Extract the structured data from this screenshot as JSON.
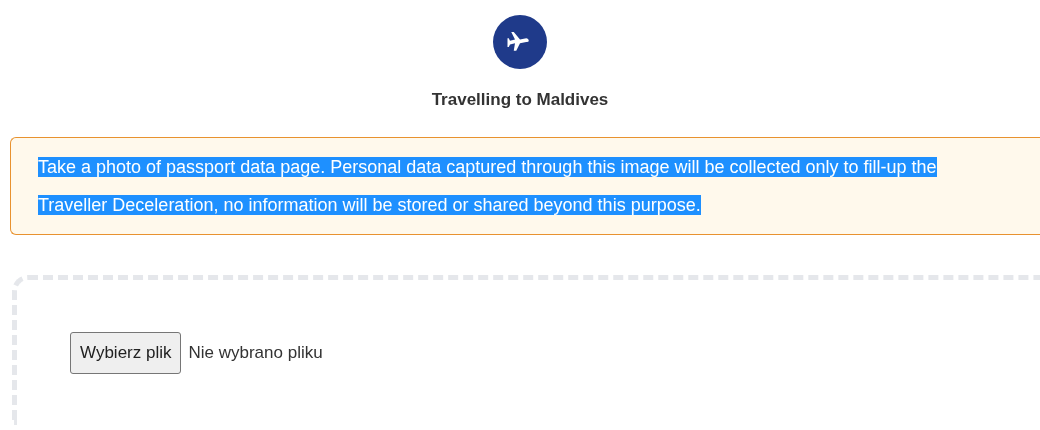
{
  "header": {
    "title": "Travelling to Maldives"
  },
  "notice": {
    "text": "Take a photo of passport data page. Personal data captured through this image will be collected only to fill-up the Traveller Deceleration, no information will be stored or shared beyond this purpose.",
    "text_selected": true
  },
  "upload": {
    "button": "Wybierz plik",
    "status": "Nie wybrano pliku"
  }
}
